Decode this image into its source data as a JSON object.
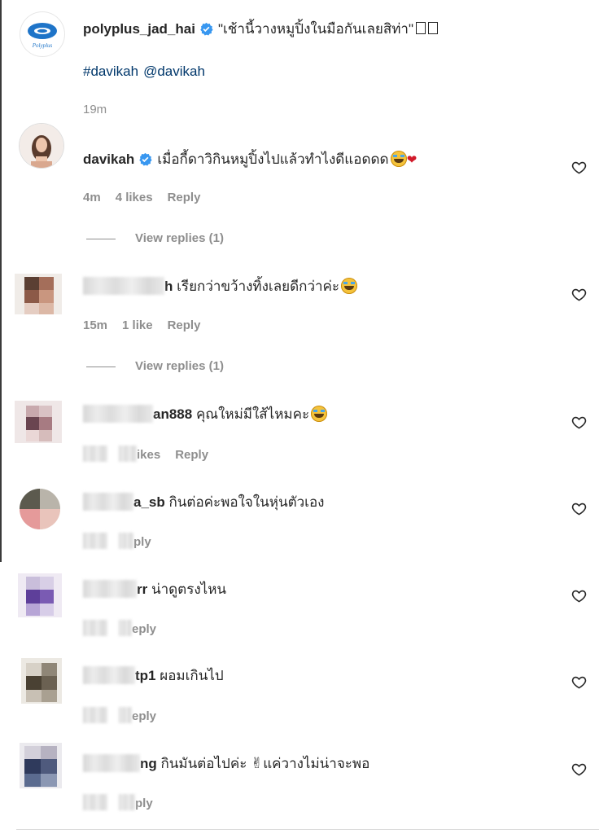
{
  "caption": {
    "username": "polyplus_jad_hai",
    "text": "\"เช้านี้วางหมูปิ้งในมือกันเลยสิท่า\"",
    "hashtag": "#davikah",
    "mention": "@davikah",
    "time": "19m",
    "logo_text": "Polyplus"
  },
  "comments": [
    {
      "username": "davikah",
      "text": "เมื่อกี้ดาวิกินหมูปิ้งไปแล้วทำไงดีแอดดด",
      "time": "4m",
      "likes": "4 likes",
      "reply": "Reply",
      "view_replies": "View replies (1)"
    },
    {
      "username_visible": "h",
      "text": "เรียกว่าขว้างทิ้งเลยดีกว่าค่ะ",
      "time": "15m",
      "likes": "1 like",
      "reply": "Reply",
      "view_replies": "View replies (1)"
    },
    {
      "username_visible": "an888",
      "text": "คุณใหม่มีใส้ไหมคะ",
      "likes_partial": "ikes",
      "reply": "Reply"
    },
    {
      "username_visible": "a_sb",
      "text": "กินต่อค่ะพอใจในหุ่นตัวเอง",
      "reply_partial": "ply"
    },
    {
      "username_visible": "rr",
      "text": "น่าดูตรงไหน",
      "reply_partial": "eply"
    },
    {
      "username_visible": "tp1",
      "text": "ผอมเกินไป",
      "reply_partial": "eply"
    },
    {
      "username_visible": "ng",
      "text": "กินมันต่อไปค่ะ",
      "text_after_emoji": "แค่วางไม่น่าจะพอ",
      "reply_partial": "ply"
    }
  ],
  "colors": {
    "verified": "#3897f0",
    "link": "#00376b",
    "muted": "#8e8e8e"
  },
  "icons": [
    "verified-badge-icon",
    "heart-icon",
    "grinning-sweat-emoji",
    "victory-hand-emoji"
  ]
}
